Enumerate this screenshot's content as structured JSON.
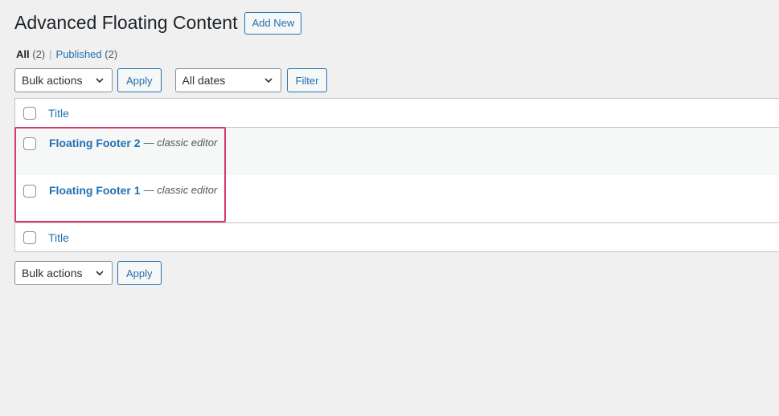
{
  "header": {
    "title": "Advanced Floating Content",
    "add_new_label": "Add New"
  },
  "views": {
    "all_label": "All",
    "all_count": "(2)",
    "separator": "|",
    "published_label": "Published",
    "published_count": "(2)"
  },
  "tablenav_top": {
    "bulk_actions": "Bulk actions",
    "apply_label": "Apply",
    "dates": "All dates",
    "filter_label": "Filter"
  },
  "table": {
    "column_title": "Title",
    "rows": [
      {
        "title": "Floating Footer 2",
        "dash": "—",
        "state": "classic editor"
      },
      {
        "title": "Floating Footer 1",
        "dash": "—",
        "state": "classic editor"
      }
    ],
    "footer_column_title": "Title"
  },
  "tablenav_bottom": {
    "bulk_actions": "Bulk actions",
    "apply_label": "Apply"
  },
  "colors": {
    "accent": "#2271b1",
    "highlight": "#d63b64",
    "background": "#f0f0f1"
  },
  "icons": {
    "select_arrow": "chevron-down-icon"
  }
}
